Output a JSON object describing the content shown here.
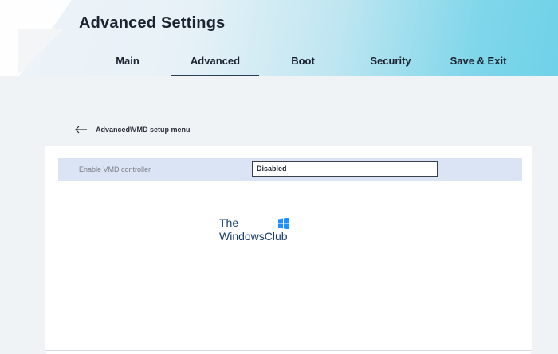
{
  "header": {
    "title": "Advanced Settings"
  },
  "tabs": [
    {
      "label": "Main",
      "active": false
    },
    {
      "label": "Advanced",
      "active": true
    },
    {
      "label": "Boot",
      "active": false
    },
    {
      "label": "Security",
      "active": false
    },
    {
      "label": "Save & Exit",
      "active": false
    }
  ],
  "breadcrumb": {
    "text": "Advanced\\VMD setup menu",
    "back_icon": "arrow-left-icon"
  },
  "settings": [
    {
      "label": "Enable VMD controller",
      "value": "Disabled"
    }
  ],
  "watermark": {
    "line1": "The",
    "line2": "WindowsClub",
    "logo_icon": "windows-logo-icon"
  },
  "colors": {
    "accent_gradient_end": "#6fd2e8",
    "row_highlight": "#dbe4f4",
    "text_dark": "#1c2330",
    "watermark_blue": "#1a3d6e",
    "logo_blue": "#1e90ff"
  }
}
